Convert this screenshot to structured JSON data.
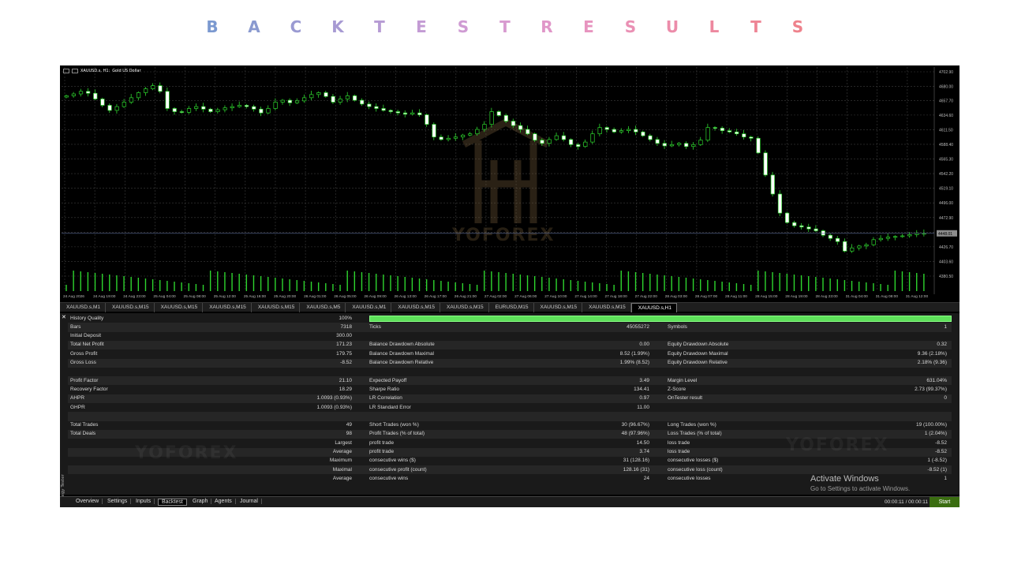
{
  "title_letters": [
    "B",
    "A",
    "C",
    "K",
    "T",
    "E",
    "S",
    "T",
    "R",
    "E",
    "S",
    "U",
    "L",
    "T",
    "S"
  ],
  "title_colors": [
    "#7b99d0",
    "#8a9ad0",
    "#9a9ad2",
    "#a79ad3",
    "#b69bd4",
    "#c39bd4",
    "#cf9bd3",
    "#d89ad0",
    "#e096c8",
    "#e794bf",
    "#ea90b4",
    "#ec8caa",
    "#ed889f",
    "#ee8595",
    "#ee828c"
  ],
  "chart": {
    "symbol": "XAUUSD.s, H1:",
    "symbol_desc": "Gold US Dollar",
    "price_levels": [
      "4702.90",
      "4680.00",
      "4657.70",
      "4634.60",
      "4611.50",
      "4588.40",
      "4565.30",
      "4542.20",
      "4519.10",
      "4496.00",
      "4472.90",
      "4449.80",
      "4426.70",
      "4403.60",
      "4380.50"
    ],
    "current_price": "4448.01",
    "time_labels": [
      "24 Aug 2026",
      "24 Aug 19:00",
      "24 Aug 23:00",
      "25 Aug 04:00",
      "25 Aug 08:00",
      "25 Aug 12:00",
      "25 Aug 16:00",
      "25 Aug 20:00",
      "26 Aug 01:00",
      "26 Aug 05:00",
      "26 Aug 09:00",
      "26 Aug 13:00",
      "26 Aug 17:00",
      "26 Aug 21:00",
      "27 Aug 02:00",
      "27 Aug 06:00",
      "27 Aug 10:00",
      "27 Aug 14:00",
      "27 Aug 18:00",
      "27 Aug 22:00",
      "28 Aug 03:00",
      "28 Aug 07:00",
      "28 Aug 11:00",
      "28 Aug 15:00",
      "28 Aug 19:00",
      "28 Aug 23:00",
      "31 Aug 04:00",
      "31 Aug 08:00",
      "31 Aug 12:00"
    ],
    "watermark": "YOFOREX",
    "candle_closes": [
      4665,
      4668,
      4672,
      4669,
      4660,
      4650,
      4642,
      4648,
      4655,
      4662,
      4670,
      4676,
      4681,
      4672,
      4645,
      4640,
      4639,
      4645,
      4648,
      4644,
      4640,
      4643,
      4646,
      4648,
      4650,
      4648,
      4644,
      4638,
      4645,
      4655,
      4658,
      4654,
      4657,
      4662,
      4667,
      4670,
      4664,
      4655,
      4660,
      4665,
      4658,
      4652,
      4648,
      4645,
      4642,
      4640,
      4638,
      4636,
      4638,
      4635,
      4620,
      4600,
      4596,
      4598,
      4600,
      4603,
      4605,
      4612,
      4620,
      4640,
      4634,
      4625,
      4618,
      4612,
      4605,
      4595,
      4590,
      4596,
      4602,
      4596,
      4588,
      4585,
      4592,
      4605,
      4615,
      4612,
      4608,
      4610,
      4612,
      4608,
      4602,
      4596,
      4590,
      4586,
      4588,
      4590,
      4585,
      4588,
      4595,
      4615,
      4614,
      4610,
      4608,
      4605,
      4600,
      4598,
      4575,
      4540,
      4510,
      4480,
      4465,
      4460,
      4458,
      4455,
      4452,
      4445,
      4440,
      4435,
      4420,
      4425,
      4428,
      4430,
      4438,
      4440,
      4442,
      4443,
      4444,
      4446,
      4448,
      4448
    ]
  },
  "chart_tabs": [
    "XAUUSD.s,M1",
    "XAUUSD.s,M15",
    "XAUUSD.s,M15",
    "XAUUSD.s,M15",
    "XAUUSD.s,M15",
    "XAUUSD.s,M5",
    "XAUUSD.s,M1",
    "XAUUSD.s,M15",
    "XAUUSD.s,M15",
    "EURUSD,M15",
    "XAUUSD.s,M15",
    "XAUUSD.s,M15",
    "XAUUSD.s,H1"
  ],
  "report_rows": [
    [
      "History Quality",
      "100%",
      "",
      "",
      "",
      ""
    ],
    [
      "Bars",
      "7318",
      "Ticks",
      "45055272",
      "Symbols",
      "1"
    ],
    [
      "Initial Deposit",
      "300.00",
      "",
      "",
      "",
      ""
    ],
    [
      "Total Net Profit",
      "171.23",
      "Balance Drawdown Absolute",
      "0.00",
      "Equity Drawdown Absolute",
      "0.32"
    ],
    [
      "Gross Profit",
      "179.75",
      "Balance Drawdown Maximal",
      "8.52 (1.99%)",
      "Equity Drawdown Maximal",
      "9.36 (2.18%)"
    ],
    [
      "Gross Loss",
      "-8.52",
      "Balance Drawdown Relative",
      "1.99% (8.52)",
      "Equity Drawdown Relative",
      "2.18% (9.36)"
    ],
    [
      "",
      "",
      "",
      "",
      "",
      ""
    ],
    [
      "Profit Factor",
      "21.10",
      "Expected Payoff",
      "3.49",
      "Margin Level",
      "631.04%"
    ],
    [
      "Recovery Factor",
      "18.29",
      "Sharpe Ratio",
      "134.41",
      "Z-Score",
      "2.73 (99.37%)"
    ],
    [
      "AHPR",
      "1.0093 (0.93%)",
      "LR Correlation",
      "0.97",
      "OnTester result",
      "0"
    ],
    [
      "GHPR",
      "1.0093 (0.93%)",
      "LR Standard Error",
      "11.00",
      "",
      ""
    ],
    [
      "",
      "",
      "",
      "",
      "",
      ""
    ],
    [
      "Total Trades",
      "49",
      "Short Trades (won %)",
      "30 (96.67%)",
      "Long Trades (won %)",
      "19 (100.00%)"
    ],
    [
      "Total Deals",
      "98",
      "Profit Trades (% of total)",
      "48 (97.96%)",
      "Loss Trades (% of total)",
      "1 (2.04%)"
    ],
    [
      "",
      "Largest",
      "profit trade",
      "14.50",
      "loss trade",
      "-8.52"
    ],
    [
      "",
      "Average",
      "profit trade",
      "3.74",
      "loss trade",
      "-8.52"
    ],
    [
      "",
      "Maximum",
      "consecutive wins ($)",
      "31 (128.16)",
      "consecutive losses ($)",
      "1 (-8.52)"
    ],
    [
      "",
      "Maximal",
      "consecutive profit (count)",
      "128.16 (31)",
      "consecutive loss (count)",
      "-8.52 (1)"
    ],
    [
      "",
      "Average",
      "consecutive wins",
      "24",
      "consecutive losses",
      "1"
    ]
  ],
  "side_label": "Strategy Tester",
  "bottom_tabs": [
    "Overview",
    "Settings",
    "Inputs",
    "Backtest",
    "Graph",
    "Agents",
    "Journal"
  ],
  "timer": "00:00:11 / 00:00:11",
  "start_label": "Start",
  "activate": {
    "line1": "Activate Windows",
    "line2": "Go to Settings to activate Windows."
  },
  "colors": {
    "bull": "#2ed52e",
    "bear": "#ffffff",
    "quality": "#5ee05a",
    "start": "#3a6d10"
  }
}
